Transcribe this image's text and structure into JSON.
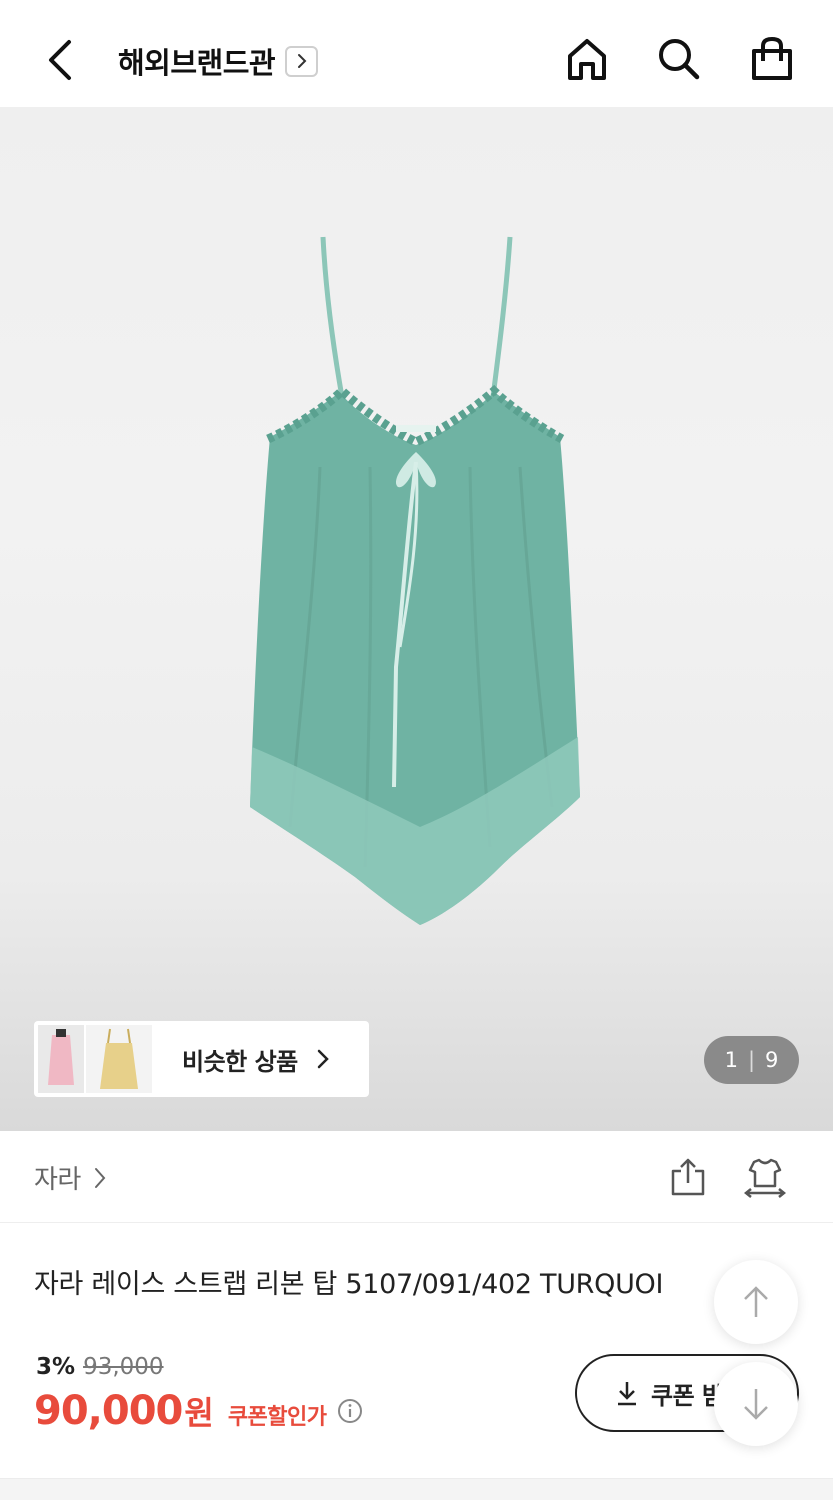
{
  "header": {
    "title": "해외브랜드관",
    "icons": [
      "back-arrow-icon",
      "chevron-right-icon",
      "home-icon",
      "search-icon",
      "shopping-bag-icon"
    ]
  },
  "gallery": {
    "similar_products_label": "비슷한 상품",
    "page_current": "1",
    "page_separator": "|",
    "page_total": "9",
    "product_color": "#6fb3a3"
  },
  "brand": {
    "name": "자라",
    "icons": [
      "chevron-right-icon",
      "share-icon",
      "compare-icon"
    ]
  },
  "product": {
    "title": "자라 레이스 스트랩 리본 탑 5107/091/402 TURQUOI",
    "discount_rate": "3%",
    "original_price": "93,000",
    "price": "90,000",
    "price_unit": "원",
    "coupon_price_label": "쿠폰할인가"
  },
  "coupon_button": {
    "label": "쿠폰 받"
  },
  "colors": {
    "accent_red": "#e84b3c",
    "text_dark": "#222222",
    "text_gray": "#666666"
  }
}
